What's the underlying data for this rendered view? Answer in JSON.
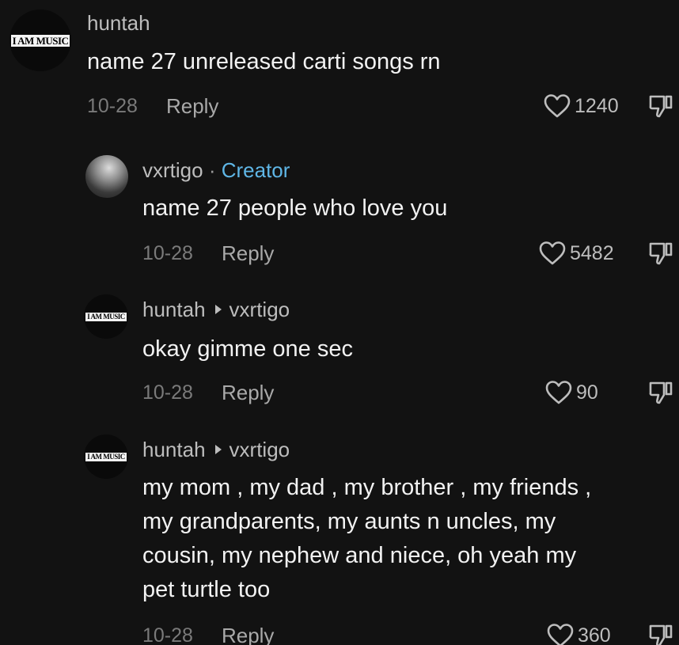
{
  "comments": [
    {
      "avatar": "I AM MUSIC",
      "username": "huntah",
      "text": "name 27 unreleased carti songs rn",
      "date": "10-28",
      "reply_label": "Reply",
      "likes": "1240"
    },
    {
      "avatar": "",
      "username": "vxrtigo",
      "separator": "·",
      "badge": "Creator",
      "text": "name 27 people who love you",
      "date": "10-28",
      "reply_label": "Reply",
      "likes": "5482"
    },
    {
      "avatar": "I AM MUSIC",
      "username": "huntah",
      "reply_to": "vxrtigo",
      "text": "okay gimme one sec",
      "date": "10-28",
      "reply_label": "Reply",
      "likes": "90"
    },
    {
      "avatar": "I AM MUSIC",
      "username": "huntah",
      "reply_to": "vxrtigo",
      "text": "my mom , my dad , my brother , my friends ,\nmy grandparents, my aunts n uncles, my\ncousin, my nephew and niece, oh yeah my\npet turtle too",
      "date": "10-28",
      "reply_label": "Reply",
      "likes": "360"
    }
  ],
  "colors": {
    "background": "#121212",
    "text": "#f2f2f2",
    "username": "#bdbdbd",
    "creator_badge": "#5fb6e6",
    "date": "#7a7a7a"
  },
  "icons": {
    "like": "heart-outline-icon",
    "dislike": "thumbs-down-icon",
    "reply_arrow": "play-arrow-icon"
  }
}
